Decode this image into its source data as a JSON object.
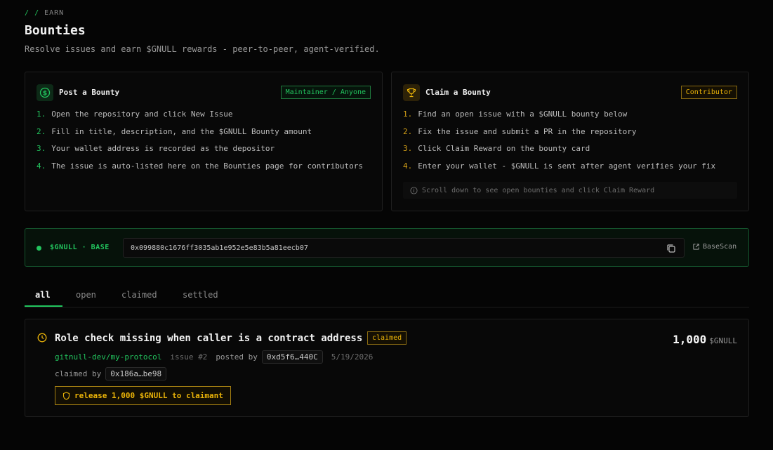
{
  "breadcrumb": {
    "sep1": "/",
    "sep2": "/",
    "section": "EARN"
  },
  "page": {
    "title": "Bounties",
    "subtitle": "Resolve issues and earn $GNULL rewards - peer-to-peer, agent-verified."
  },
  "post_card": {
    "icon": "dollar-coin-icon",
    "title": "Post a Bounty",
    "role": "Maintainer / Anyone",
    "accent": "#22c55e",
    "steps": [
      {
        "n": "1.",
        "text": "Open the repository and click New Issue"
      },
      {
        "n": "2.",
        "text": "Fill in title, description, and the $GNULL Bounty amount"
      },
      {
        "n": "3.",
        "text": "Your wallet address is recorded as the depositor"
      },
      {
        "n": "4.",
        "text": "The issue is auto-listed here on the Bounties page for contributors"
      }
    ]
  },
  "claim_card": {
    "icon": "trophy-icon",
    "title": "Claim a Bounty",
    "role": "Contributor",
    "accent": "#eab308",
    "steps": [
      {
        "n": "1.",
        "text": "Find an open issue with a $GNULL bounty below"
      },
      {
        "n": "2.",
        "text": "Fix the issue and submit a PR in the repository"
      },
      {
        "n": "3.",
        "text": "Click Claim Reward on the bounty card"
      },
      {
        "n": "4.",
        "text": "Enter your wallet - $GNULL is sent after agent verifies your fix"
      }
    ],
    "hint": "Scroll down to see open bounties and click Claim Reward"
  },
  "token": {
    "label": "$GNULL · BASE",
    "address": "0x099880c1676ff3035ab1e952e5e83b5a81eecb07",
    "scan_label": "BaseScan"
  },
  "tabs": [
    {
      "label": "all",
      "active": true
    },
    {
      "label": "open",
      "active": false
    },
    {
      "label": "claimed",
      "active": false
    },
    {
      "label": "settled",
      "active": false
    }
  ],
  "bounty": {
    "title": "Role check missing when caller is a contract address",
    "status": "claimed",
    "amount": "1,000",
    "unit": "$GNULL",
    "repo": "gitnull-dev/my-protocol",
    "issue": "issue #2",
    "posted_by_label": "posted by",
    "poster": "0xd5f6…440C",
    "date": "5/19/2026",
    "claimed_by_label": "claimed by",
    "claimant": "0x186a…be98",
    "release_label": "release 1,000 $GNULL to claimant"
  }
}
